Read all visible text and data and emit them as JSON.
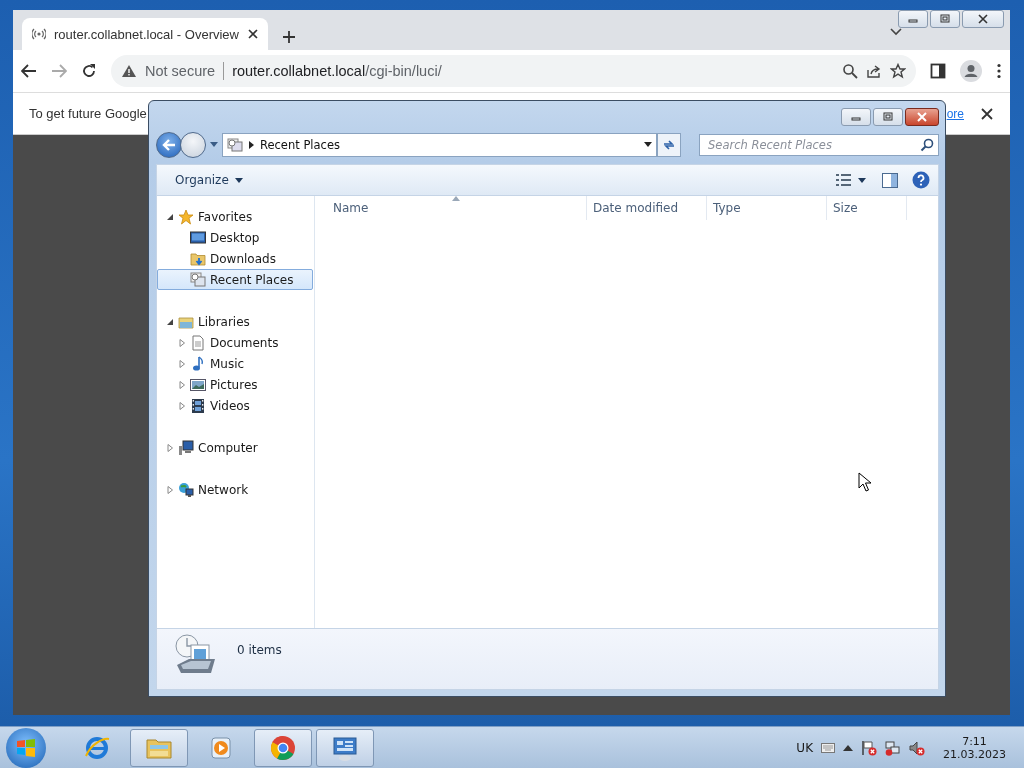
{
  "browser": {
    "tab": {
      "title": "router.collabnet.local - Overview",
      "selected": true
    },
    "address": {
      "warning": "Not secure",
      "host": "router.collabnet.local",
      "path": "/cgi-bin/luci/"
    },
    "infobar": {
      "text": "To get future Google",
      "link": "ore"
    }
  },
  "explorer": {
    "breadcrumb": "Recent Places",
    "search": {
      "placeholder": "Search Recent Places"
    },
    "toolbar": {
      "organize": "Organize"
    },
    "nav": [
      {
        "label": "Favorites",
        "expanded": true,
        "selected": false,
        "children": [
          {
            "label": "Desktop",
            "selected": false
          },
          {
            "label": "Downloads",
            "selected": false
          },
          {
            "label": "Recent Places",
            "selected": true
          }
        ]
      },
      {
        "label": "Libraries",
        "expanded": true,
        "selected": false,
        "children": [
          {
            "label": "Documents",
            "selected": false,
            "expanded": false
          },
          {
            "label": "Music",
            "selected": false,
            "expanded": false
          },
          {
            "label": "Pictures",
            "selected": false,
            "expanded": false
          },
          {
            "label": "Videos",
            "selected": false,
            "expanded": false
          }
        ]
      },
      {
        "label": "Computer",
        "expanded": false,
        "selected": false
      },
      {
        "label": "Network",
        "expanded": false,
        "selected": false
      }
    ],
    "columns": [
      "Name",
      "Date modified",
      "Type",
      "Size"
    ],
    "status": "0 items"
  },
  "taskbar": {
    "items": [
      {
        "kind": "ie",
        "open": false
      },
      {
        "kind": "explorer",
        "open": true
      },
      {
        "kind": "media",
        "open": false
      },
      {
        "kind": "chrome",
        "open": true
      },
      {
        "kind": "panel",
        "open": true
      }
    ],
    "tray": {
      "language": "UK",
      "time": "7:11",
      "date": "21.03.2023"
    }
  }
}
